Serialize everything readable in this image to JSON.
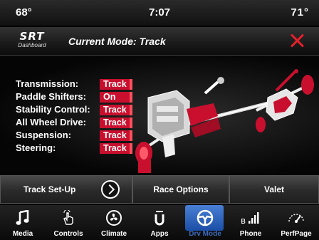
{
  "status": {
    "temp_left": "68°",
    "time": "7:07",
    "temp_right": "71°"
  },
  "header": {
    "logo_text": "SRT",
    "logo_subtext": "Dashboard",
    "title": "Current Mode: Track"
  },
  "settings": [
    {
      "label": "Transmission:",
      "value": "Track"
    },
    {
      "label": "Paddle Shifters:",
      "value": "On"
    },
    {
      "label": "Stability Control:",
      "value": "Track"
    },
    {
      "label": "All Wheel Drive:",
      "value": "Track"
    },
    {
      "label": "Suspension:",
      "value": "Track"
    },
    {
      "label": "Steering:",
      "value": "Track"
    }
  ],
  "buttons": {
    "track_setup": "Track Set-Up",
    "race_options": "Race Options",
    "valet": "Valet"
  },
  "nav": [
    {
      "label": "Media",
      "icon": "music-note-icon"
    },
    {
      "label": "Controls",
      "icon": "hand-touch-icon"
    },
    {
      "label": "Climate",
      "icon": "climate-fan-icon"
    },
    {
      "label": "Apps",
      "icon": "apps-icon"
    },
    {
      "label": "Drv Mode",
      "icon": "steering-wheel-icon",
      "active": true
    },
    {
      "label": "Phone",
      "icon": "phone-signal-icon"
    },
    {
      "label": "PerfPage",
      "icon": "performance-gauge-icon"
    }
  ],
  "colors": {
    "accent": "#c8102e",
    "close": "#e4202a",
    "active_nav": "#2e63c0"
  }
}
